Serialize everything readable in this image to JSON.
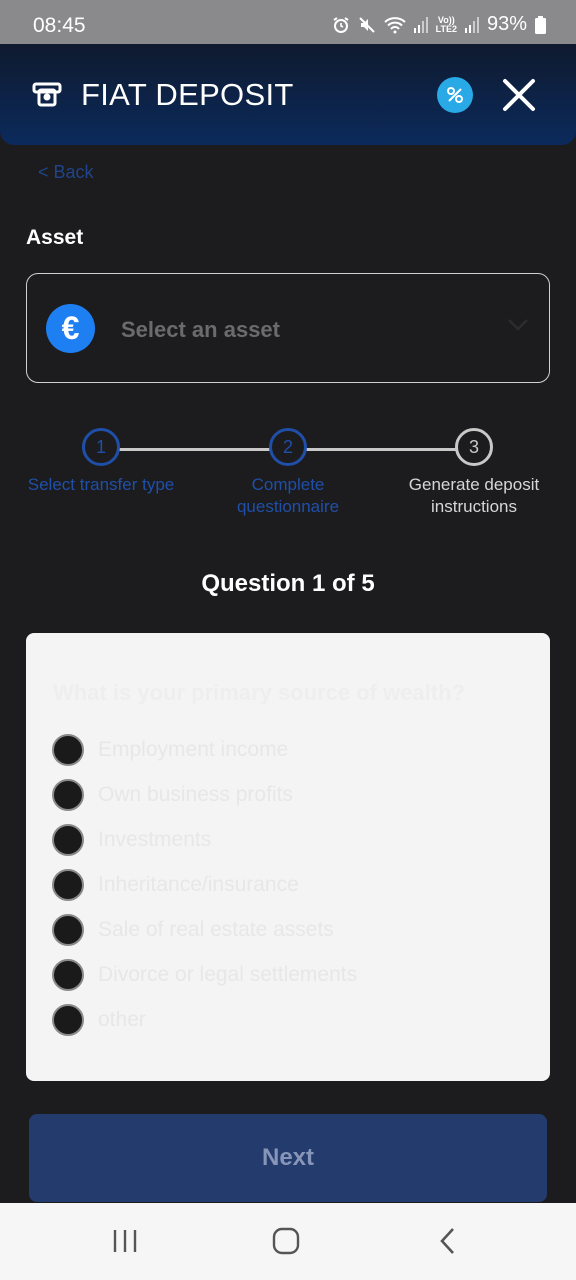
{
  "status_bar": {
    "time": "08:45",
    "battery": "93%",
    "network_top": "Vo))",
    "network_bottom": "LTE2",
    "icons": [
      "alarm-icon",
      "mute-icon",
      "wifi-icon",
      "signal-icon",
      "signal-icon",
      "battery-icon"
    ]
  },
  "header": {
    "title": "FIAT DEPOSIT",
    "icons": [
      "deposit-icon",
      "promo-icon",
      "close-icon"
    ],
    "accent_color": "#0b2a5c"
  },
  "back": {
    "label": "< Back"
  },
  "asset": {
    "label": "Asset",
    "placeholder": "Select an asset",
    "currency_symbol": "€",
    "icons": [
      "euro-icon",
      "chevron-down-icon"
    ]
  },
  "stepper": {
    "steps": [
      {
        "number": "1",
        "label": "Select transfer type"
      },
      {
        "number": "2",
        "label": "Complete questionnaire"
      },
      {
        "number": "3",
        "label": "Generate deposit instructions"
      }
    ],
    "active_step": 3,
    "colors": {
      "completed": "#1f4fa8",
      "active": "#c8c8c8"
    }
  },
  "question": {
    "progress": "Question 1 of 5",
    "text": "What is your primary source of wealth?",
    "options": [
      "Employment income",
      "Own business profits",
      "Investments",
      "Inheritance/insurance",
      "Sale of real estate assets",
      "Divorce or legal settlements",
      "other"
    ]
  },
  "actions": {
    "next_label": "Next"
  },
  "nav_bar": {
    "icons": [
      "recent-apps-icon",
      "home-icon",
      "back-icon"
    ]
  }
}
